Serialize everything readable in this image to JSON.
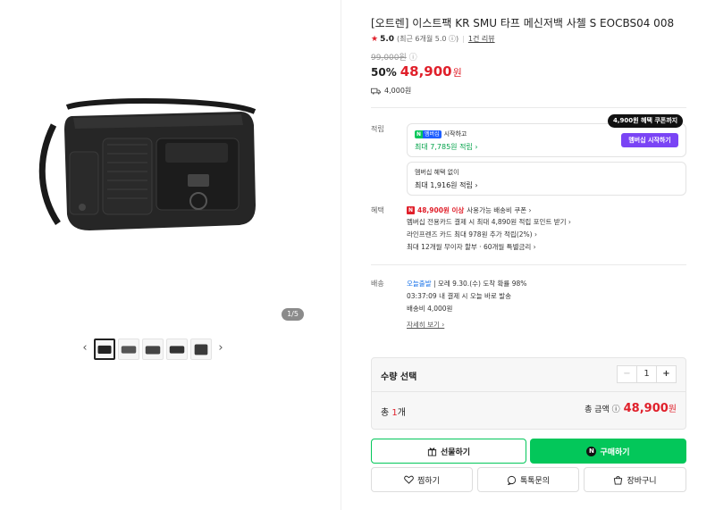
{
  "gallery": {
    "page_indicator": "1/5",
    "prev_arrow": "‹",
    "next_arrow": "›"
  },
  "product": {
    "title": "[오트렌] 이스트팩 KR SMU 타프 메신저백 사첼 S EOCBS04 008",
    "rating_star": "★",
    "rating_score": "5.0",
    "rating_detail": "(최근 6개월 5.0 ⓘ)",
    "review_link": "1건 리뷰",
    "original_price": "99,000원",
    "original_price_info": "ⓘ",
    "discount_rate": "50%",
    "sale_price": "48,900",
    "currency": "원",
    "shipping_fee": "4,000원"
  },
  "points": {
    "label": "적립",
    "npay_start": "시작하고",
    "npay_badge_n": "N",
    "npay_badge_p": "멤버십",
    "max_points": "최대 7,785원 적립 ›",
    "tooltip": "4,900원 혜택 쿠폰까지",
    "membership_button": "멤버십 시작하기",
    "no_membership": "멤버십 혜택 없이",
    "max_points_basic": "최대 1,916원 적립 ›"
  },
  "benefits": {
    "label": "혜택",
    "coupon_badge": "N",
    "coupon_highlight": "48,900원 이상",
    "coupon_text": "사용가능 배송비 쿠폰 ›",
    "line2": "멤버십 전용카드 결제 시 최대 4,890원 적립 포인트 받기 ›",
    "line3": "라인프렌즈 카드 최대 978원 추가 적립(2%) ›",
    "line4": "최대 12개월 무이자 할부 · 60개월 특별금리 ›"
  },
  "delivery": {
    "label": "배송",
    "today": "오늘출발",
    "eta": "모레 9.30.(수) 도착 확률 98%",
    "cutoff": "03:37:09  내 결제 시 오늘 바로 발송",
    "fee": "배송비 4,000원",
    "details_link": "자세히 보기 ›"
  },
  "quantity": {
    "label": "수량 선택",
    "minus": "−",
    "value": "1",
    "plus": "+",
    "total_prefix": "총 ",
    "total_count": "1",
    "total_suffix": "개",
    "total_label": "총 금액 ⓘ",
    "total_value": "48,900",
    "total_currency": "원"
  },
  "actions": {
    "gift": "선물하기",
    "buy": "구매하기",
    "buy_badge": "N",
    "wish": "찜하기",
    "talk": "톡톡문의",
    "cart": "장바구니"
  },
  "colors": {
    "accent_red": "#e0202b",
    "naver_green": "#03c75a",
    "membership_purple": "#7a44f5"
  }
}
